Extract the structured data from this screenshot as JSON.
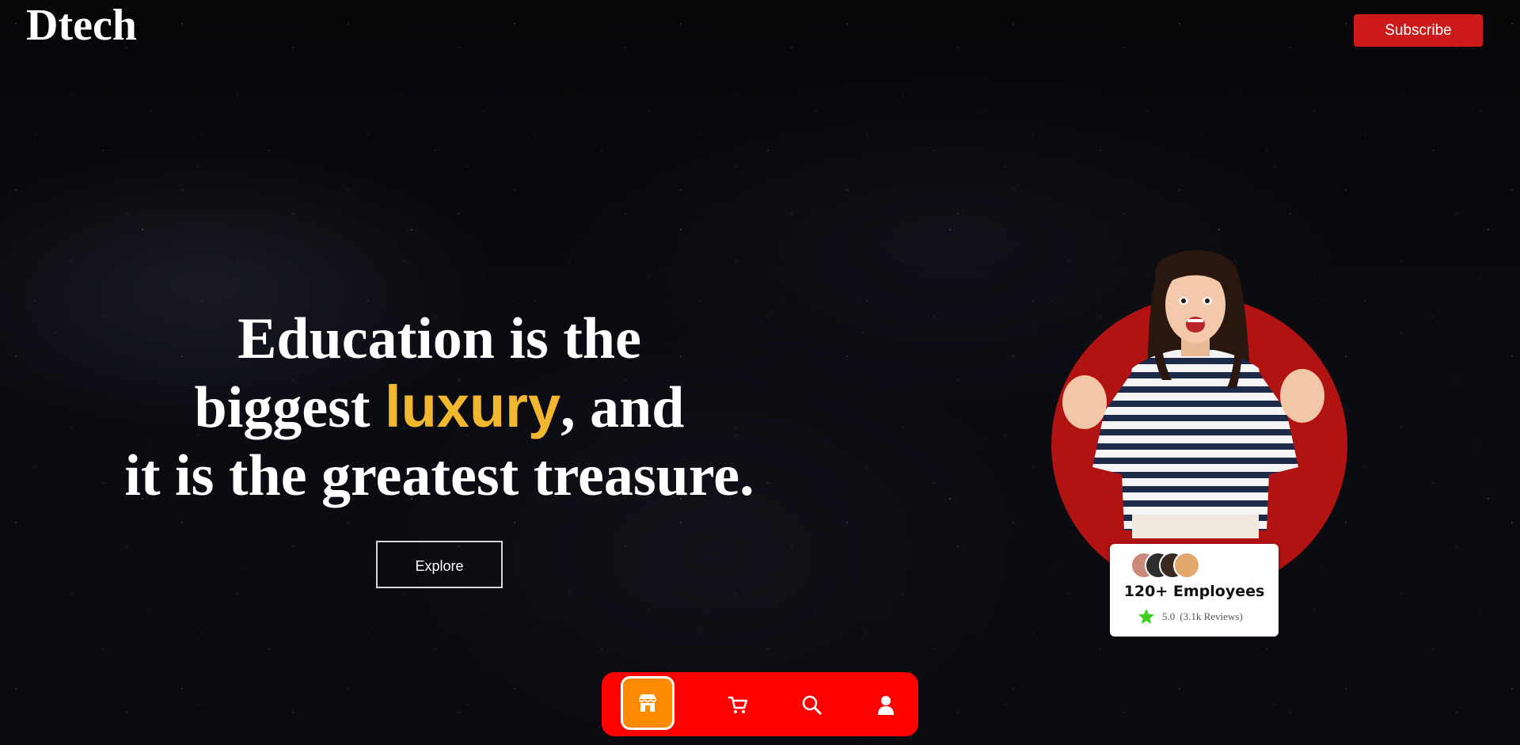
{
  "header": {
    "logo": "Dtech",
    "subscribe_label": "Subscribe"
  },
  "hero": {
    "line1": "Education is the",
    "line2_pre": "biggest ",
    "line2_accent": "luxury",
    "line2_post": ", and",
    "line3": "it is the greatest treasure.",
    "explore_label": "Explore"
  },
  "card": {
    "title": "120+ Employees",
    "rating": "5.0",
    "reviews": "(3.1k Reviews)"
  },
  "bottom_nav": {
    "items": [
      {
        "icon": "store-icon",
        "active": true
      },
      {
        "icon": "cart-icon",
        "active": false
      },
      {
        "icon": "search-icon",
        "active": false
      },
      {
        "icon": "user-icon",
        "active": false
      }
    ]
  },
  "colors": {
    "accent": "#f1b72f",
    "brand_red": "#cc1a1a",
    "nav_red": "#ff0000",
    "nav_active": "#ff8a00",
    "star_green": "#3fce1d"
  }
}
